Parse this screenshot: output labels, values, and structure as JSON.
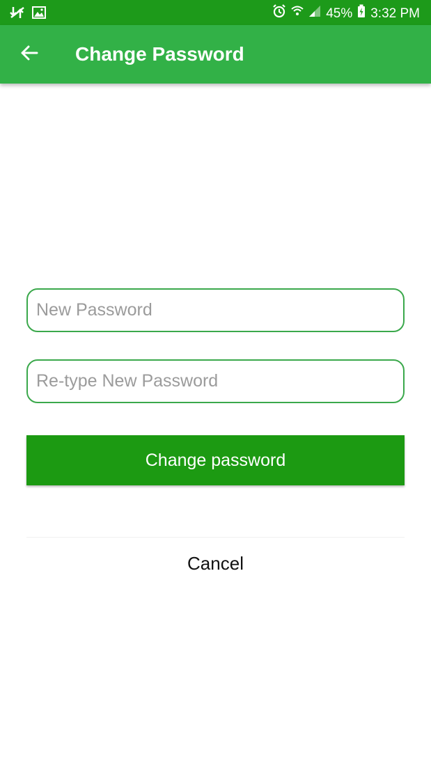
{
  "status_bar": {
    "battery": "45%",
    "time": "3:32 PM",
    "icons": [
      "data-transfer-icon",
      "image-icon",
      "alarm-icon",
      "wifi-icon",
      "signal-icon",
      "battery-charging-icon"
    ]
  },
  "app_bar": {
    "title": "Change Password",
    "back_icon": "arrow-back-icon",
    "color": "#32b147"
  },
  "form": {
    "new_password_placeholder": "New Password",
    "retype_password_placeholder": "Re-type New Password",
    "submit_label": "Change password",
    "cancel_label": "Cancel",
    "accent_color": "#3aa84b",
    "button_color": "#1c9a12"
  }
}
